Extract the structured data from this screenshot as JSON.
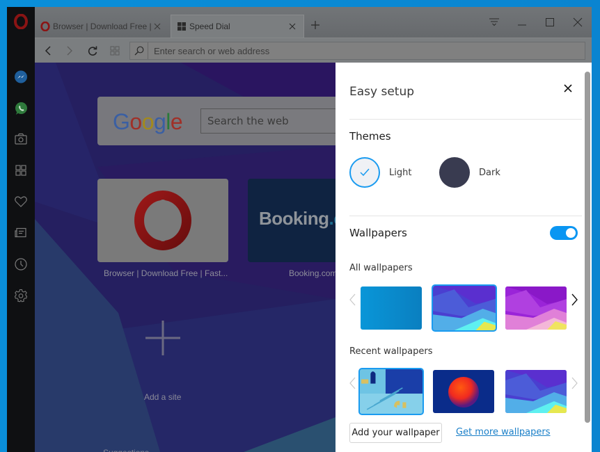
{
  "browser": {
    "sidebar": {
      "items": [
        {
          "name": "messenger",
          "icon": "messenger-icon"
        },
        {
          "name": "whatsapp",
          "icon": "whatsapp-icon"
        },
        {
          "name": "snapshot",
          "icon": "camera-icon"
        },
        {
          "name": "speed-dial",
          "icon": "grid-icon"
        },
        {
          "name": "bookmarks",
          "icon": "heart-icon"
        },
        {
          "name": "news",
          "icon": "news-icon"
        },
        {
          "name": "history",
          "icon": "clock-icon"
        },
        {
          "name": "settings",
          "icon": "gear-icon"
        }
      ]
    },
    "tabs": [
      {
        "label": "Browser | Download Free |",
        "active": false,
        "icon": "opera-icon"
      },
      {
        "label": "Speed Dial",
        "active": true,
        "icon": "speed-dial-icon"
      }
    ],
    "address_bar": {
      "placeholder": "Enter search or web address",
      "value": ""
    }
  },
  "speed_dial": {
    "search": {
      "logo": [
        "G",
        "o",
        "o",
        "g",
        "l",
        "e"
      ],
      "placeholder": "Search the web"
    },
    "tiles": [
      {
        "label": "Browser | Download Free | Fast...",
        "site": "opera"
      },
      {
        "label": "Booking.com",
        "logo_main": "Booking",
        "logo_dot": ".c"
      }
    ],
    "add_site_label": "Add a site",
    "suggestions_label": "Suggestions"
  },
  "easy_setup": {
    "title": "Easy setup",
    "themes": {
      "heading": "Themes",
      "options": [
        {
          "label": "Light",
          "selected": true
        },
        {
          "label": "Dark",
          "selected": false
        }
      ]
    },
    "wallpapers": {
      "heading": "Wallpapers",
      "enabled": true,
      "all_heading": "All wallpapers",
      "all": [
        {
          "name": "blue-solid",
          "selected": false
        },
        {
          "name": "blue-purple-geometric",
          "selected": true
        },
        {
          "name": "purple-pink-geometric",
          "selected": false
        }
      ],
      "recent_heading": "Recent wallpapers",
      "recent": [
        {
          "name": "blue-3d-room",
          "selected": true
        },
        {
          "name": "red-sphere",
          "selected": false
        },
        {
          "name": "blue-purple-geometric",
          "selected": false
        }
      ],
      "add_button": "Add your wallpaper",
      "more_link": "Get more wallpapers"
    }
  },
  "colors": {
    "accent": "#1a9bf0",
    "toggle_on": "#0a96f2",
    "link": "#1a7fc8",
    "dark_theme_swatch": "#393b50"
  }
}
